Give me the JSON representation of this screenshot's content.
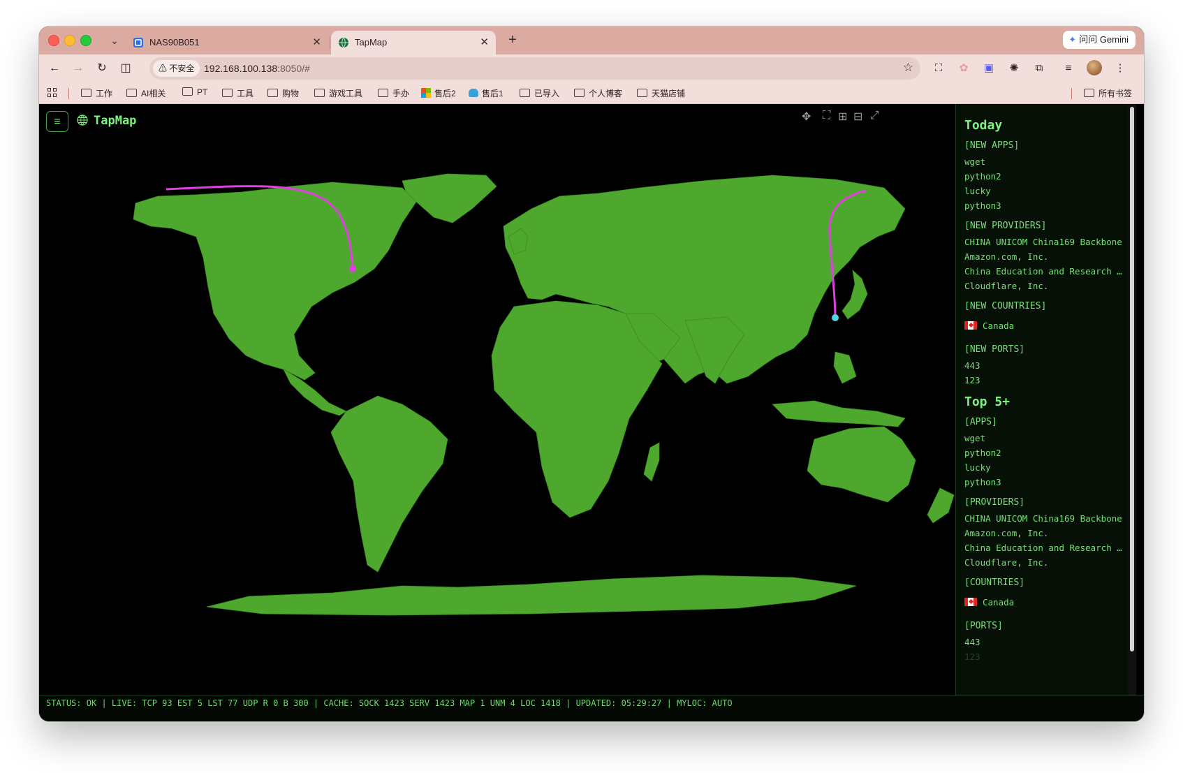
{
  "browser": {
    "tabs": [
      {
        "title": "NAS90B051",
        "active": false
      },
      {
        "title": "TapMap",
        "active": true
      }
    ],
    "gemini_label": "问问 Gemini",
    "security_label": "不安全",
    "url_host": "192.168.100.138",
    "url_rest": ":8050/#",
    "bookmarks": [
      "工作",
      "AI相关",
      "PT",
      "工具",
      "购物",
      "游戏工具",
      "手办",
      "售后2",
      "售后1",
      "已导入",
      "个人博客",
      "天猫店铺"
    ],
    "all_bookmarks": "所有书签"
  },
  "app": {
    "title": "TapMap",
    "menu_icon": "≡",
    "map": {
      "land_color": "#4ea82e",
      "ocean_color": "#000000",
      "arc_color": "#e040e0",
      "endpoint_colors": [
        "#e040e0",
        "#4fd6e6"
      ]
    },
    "sidebar": {
      "today": {
        "heading": "Today",
        "new_apps_label": "[NEW APPS]",
        "new_apps": [
          "wget",
          "python2",
          "lucky",
          "python3"
        ],
        "new_providers_label": "[NEW PROVIDERS]",
        "new_providers": [
          "CHINA UNICOM China169 Backbone",
          "Amazon.com, Inc.",
          "China Education and Research Network",
          "Cloudflare, Inc."
        ],
        "new_countries_label": "[NEW COUNTRIES]",
        "new_countries": [
          "Canada"
        ],
        "new_ports_label": "[NEW PORTS]",
        "new_ports": [
          "443",
          "123"
        ]
      },
      "top": {
        "heading": "Top 5+",
        "apps_label": "[APPS]",
        "apps": [
          "wget",
          "python2",
          "lucky",
          "python3"
        ],
        "providers_label": "[PROVIDERS]",
        "providers": [
          "CHINA UNICOM China169 Backbone",
          "Amazon.com, Inc.",
          "China Education and Research Network",
          "Cloudflare, Inc."
        ],
        "countries_label": "[COUNTRIES]",
        "countries": [
          "Canada"
        ],
        "ports_label": "[PORTS]",
        "ports": [
          "443",
          "123"
        ]
      }
    },
    "status_line": "STATUS: OK | LIVE: TCP 93 EST 5 LST 77 UDP R 0 B 300 | CACHE: SOCK 1423 SERV 1423 MAP 1 UNM 4 LOC 1418 | UPDATED: 05:29:27 | MYLOC: AUTO"
  }
}
